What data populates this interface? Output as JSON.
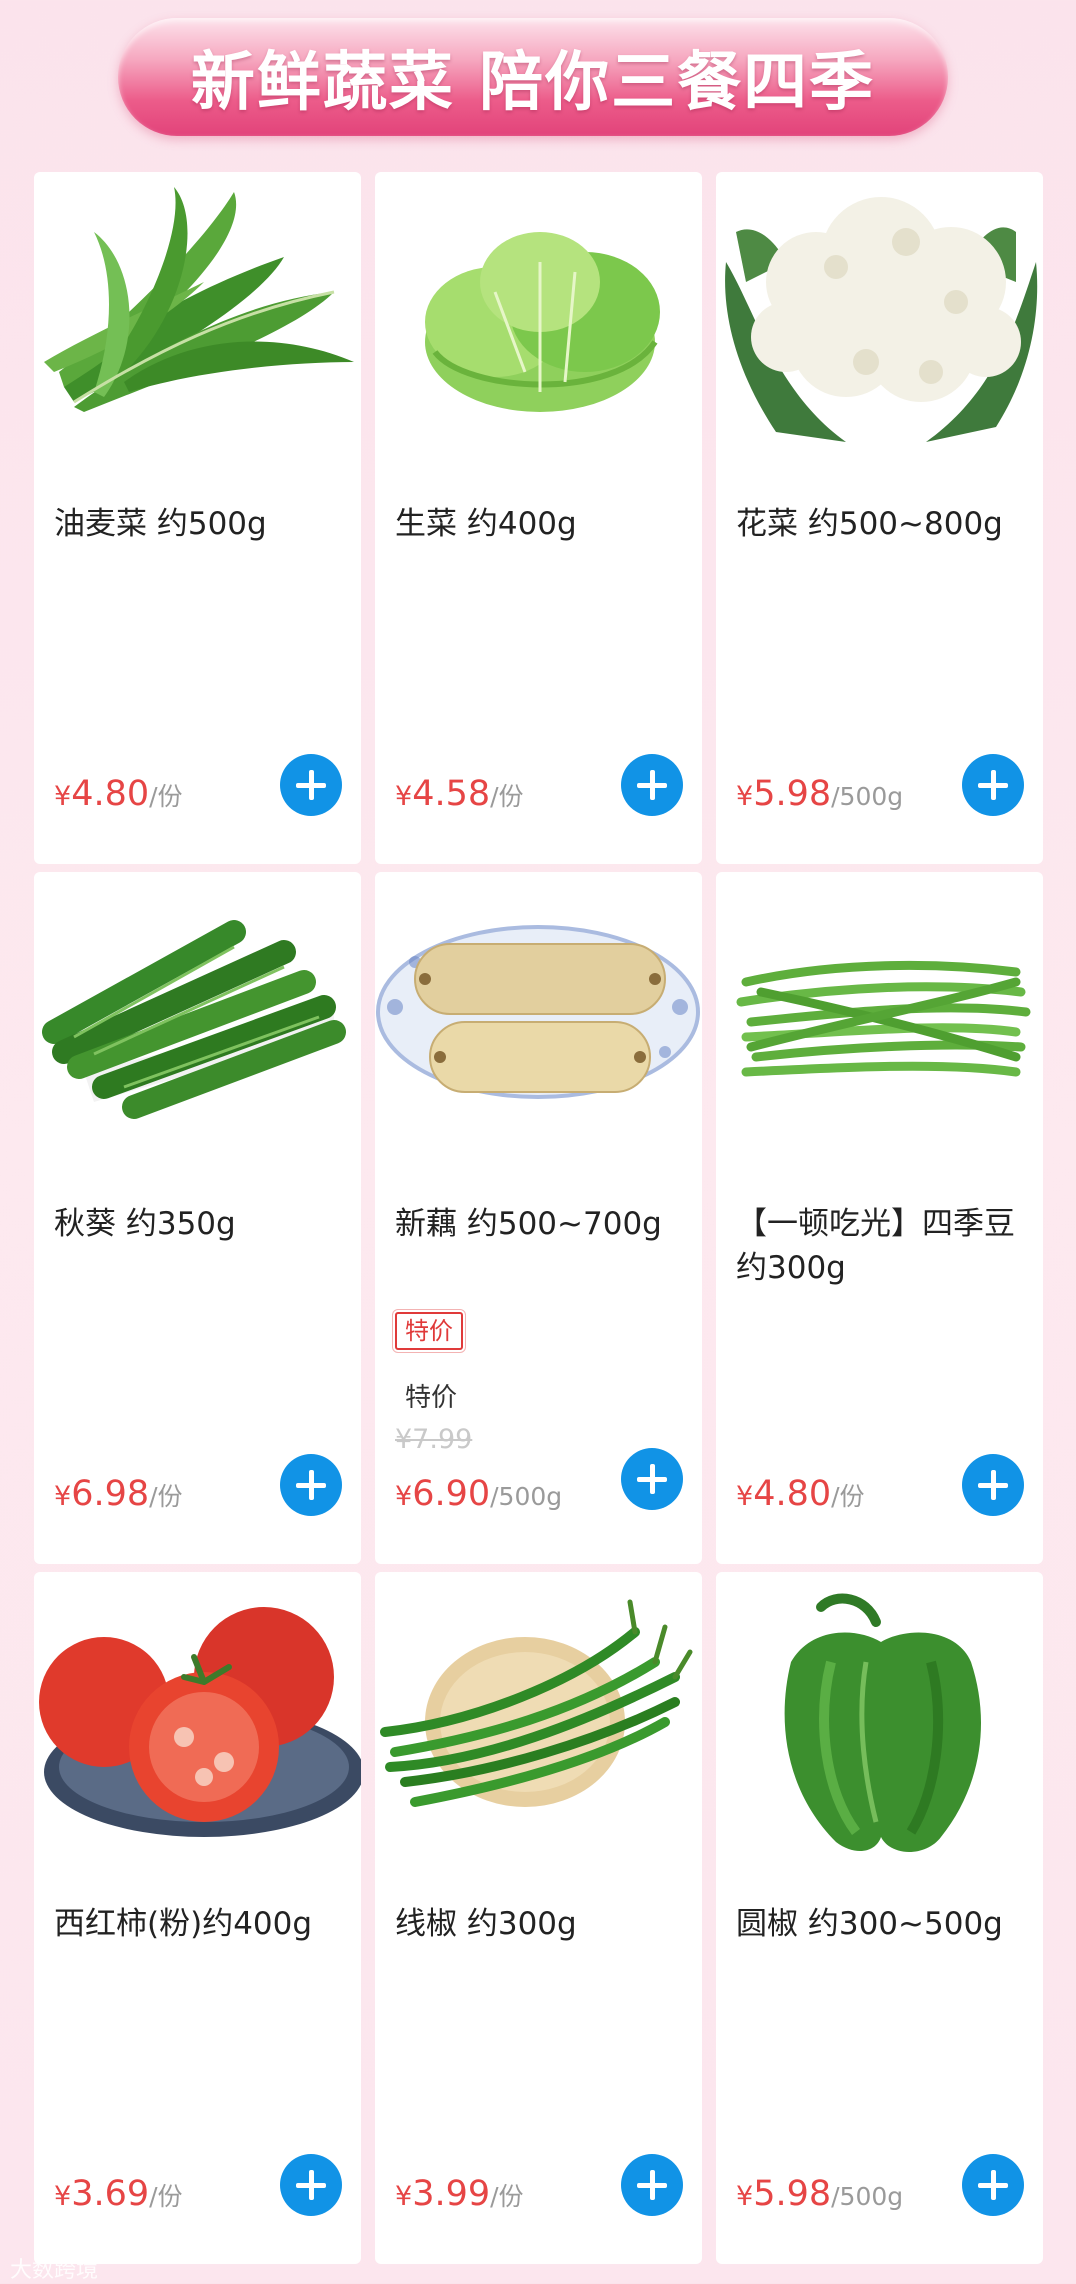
{
  "banner": {
    "text": "新鲜蔬菜 陪你三餐四季"
  },
  "products": [
    {
      "name": "油麦菜 约500g",
      "currency": "¥",
      "price": "4.80",
      "unit": "/份",
      "image": "romaine-lettuce-image",
      "tag": "",
      "promo": "",
      "old_price": ""
    },
    {
      "name": "生菜 约400g",
      "currency": "¥",
      "price": "4.58",
      "unit": "/份",
      "image": "lettuce-image",
      "tag": "",
      "promo": "",
      "old_price": ""
    },
    {
      "name": "花菜 约500~800g",
      "currency": "¥",
      "price": "5.98",
      "unit": "/500g",
      "image": "cauliflower-image",
      "tag": "",
      "promo": "",
      "old_price": ""
    },
    {
      "name": "秋葵 约350g",
      "currency": "¥",
      "price": "6.98",
      "unit": "/份",
      "image": "okra-image",
      "tag": "",
      "promo": "",
      "old_price": ""
    },
    {
      "name": "新藕 约500~700g",
      "currency": "¥",
      "price": "6.90",
      "unit": "/500g",
      "image": "lotus-root-image",
      "tag": "特价",
      "promo": "特价",
      "old_price": "¥7.99"
    },
    {
      "name": "【一顿吃光】四季豆 约300g",
      "currency": "¥",
      "price": "4.80",
      "unit": "/份",
      "image": "green-beans-image",
      "tag": "",
      "promo": "",
      "old_price": ""
    },
    {
      "name": "西红柿(粉)约400g",
      "currency": "¥",
      "price": "3.69",
      "unit": "/份",
      "image": "tomato-image",
      "tag": "",
      "promo": "",
      "old_price": ""
    },
    {
      "name": "线椒 约300g",
      "currency": "¥",
      "price": "3.99",
      "unit": "/份",
      "image": "chili-pepper-image",
      "tag": "",
      "promo": "",
      "old_price": ""
    },
    {
      "name": "圆椒 约300~500g",
      "currency": "¥",
      "price": "5.98",
      "unit": "/500g",
      "image": "bell-pepper-image",
      "tag": "",
      "promo": "",
      "old_price": ""
    }
  ],
  "colors": {
    "accent": "#1193e6",
    "price": "#e64545",
    "banner": "#e2437a"
  },
  "watermark": "大数跨境"
}
